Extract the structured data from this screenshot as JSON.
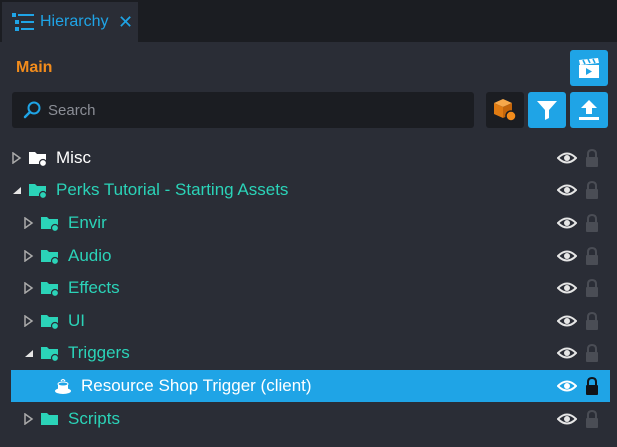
{
  "tab": {
    "label": "Hierarchy",
    "close": "✕"
  },
  "section": {
    "title": "Main"
  },
  "search": {
    "placeholder": "Search",
    "value": ""
  },
  "colors": {
    "accent": "#1fa4e6",
    "orange": "#f28c1c",
    "teal": "#2bd3b8",
    "background": "#2a2d36",
    "header": "#1b1d22"
  },
  "tree": [
    {
      "label": "Misc",
      "expanded": false,
      "icon": "folder-icon",
      "color": "#ffffff"
    },
    {
      "label": "Perks Tutorial - Starting Assets",
      "expanded": true,
      "icon": "folder-icon",
      "color": "#2bd3b8"
    },
    {
      "label": "Envir",
      "expanded": false,
      "icon": "folder-icon",
      "color": "#2bd3b8"
    },
    {
      "label": "Audio",
      "expanded": false,
      "icon": "folder-icon",
      "color": "#2bd3b8"
    },
    {
      "label": "Effects",
      "expanded": false,
      "icon": "folder-icon",
      "color": "#2bd3b8"
    },
    {
      "label": "UI",
      "expanded": false,
      "icon": "folder-icon",
      "color": "#2bd3b8"
    },
    {
      "label": "Triggers",
      "expanded": true,
      "icon": "folder-icon",
      "color": "#2bd3b8"
    },
    {
      "label": "Resource Shop Trigger (client)",
      "expanded": null,
      "icon": "trigger-icon",
      "color": "#ffffff",
      "selected": true
    },
    {
      "label": "Scripts",
      "expanded": false,
      "icon": "folder-icon",
      "color": "#2bd3b8"
    }
  ]
}
